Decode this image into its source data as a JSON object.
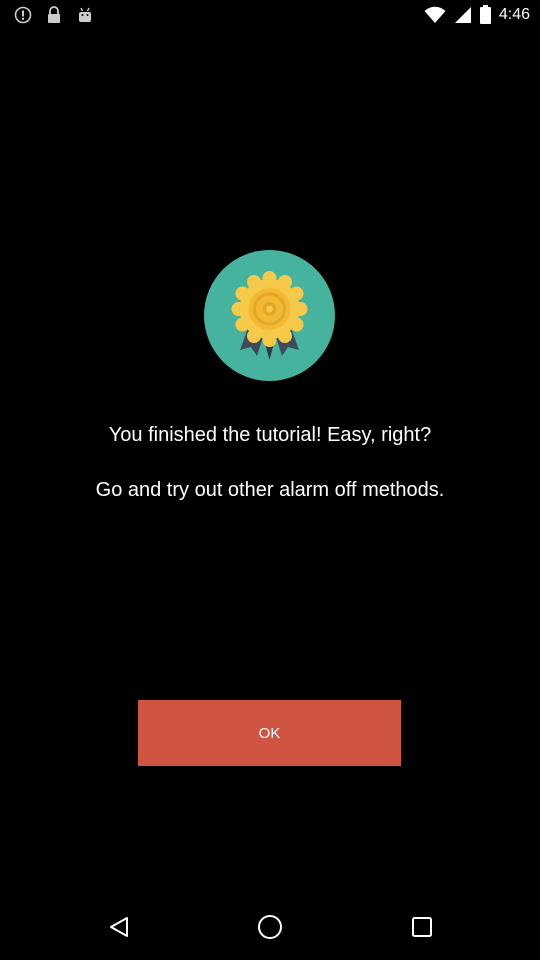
{
  "status_bar": {
    "time": "4:46",
    "left_icons": [
      "alert-circle-icon",
      "lock-icon",
      "android-icon"
    ],
    "right_icons": [
      "wifi-icon",
      "signal-icon",
      "battery-icon"
    ]
  },
  "tutorial": {
    "badge_icon": "medal-icon",
    "title": "You finished the tutorial! Easy, right?",
    "subtitle": "Go and try out other alarm off methods."
  },
  "actions": {
    "ok_label": "OK"
  },
  "navigation": {
    "back_icon": "back-triangle-icon",
    "home_icon": "home-circle-icon",
    "recents_icon": "recents-square-icon"
  },
  "colors": {
    "background": "#000000",
    "badge_circle": "#45b39d",
    "medal_gold": "#f7c948",
    "ribbon": "#3f4a5c",
    "ok_button": "#cf5442"
  }
}
